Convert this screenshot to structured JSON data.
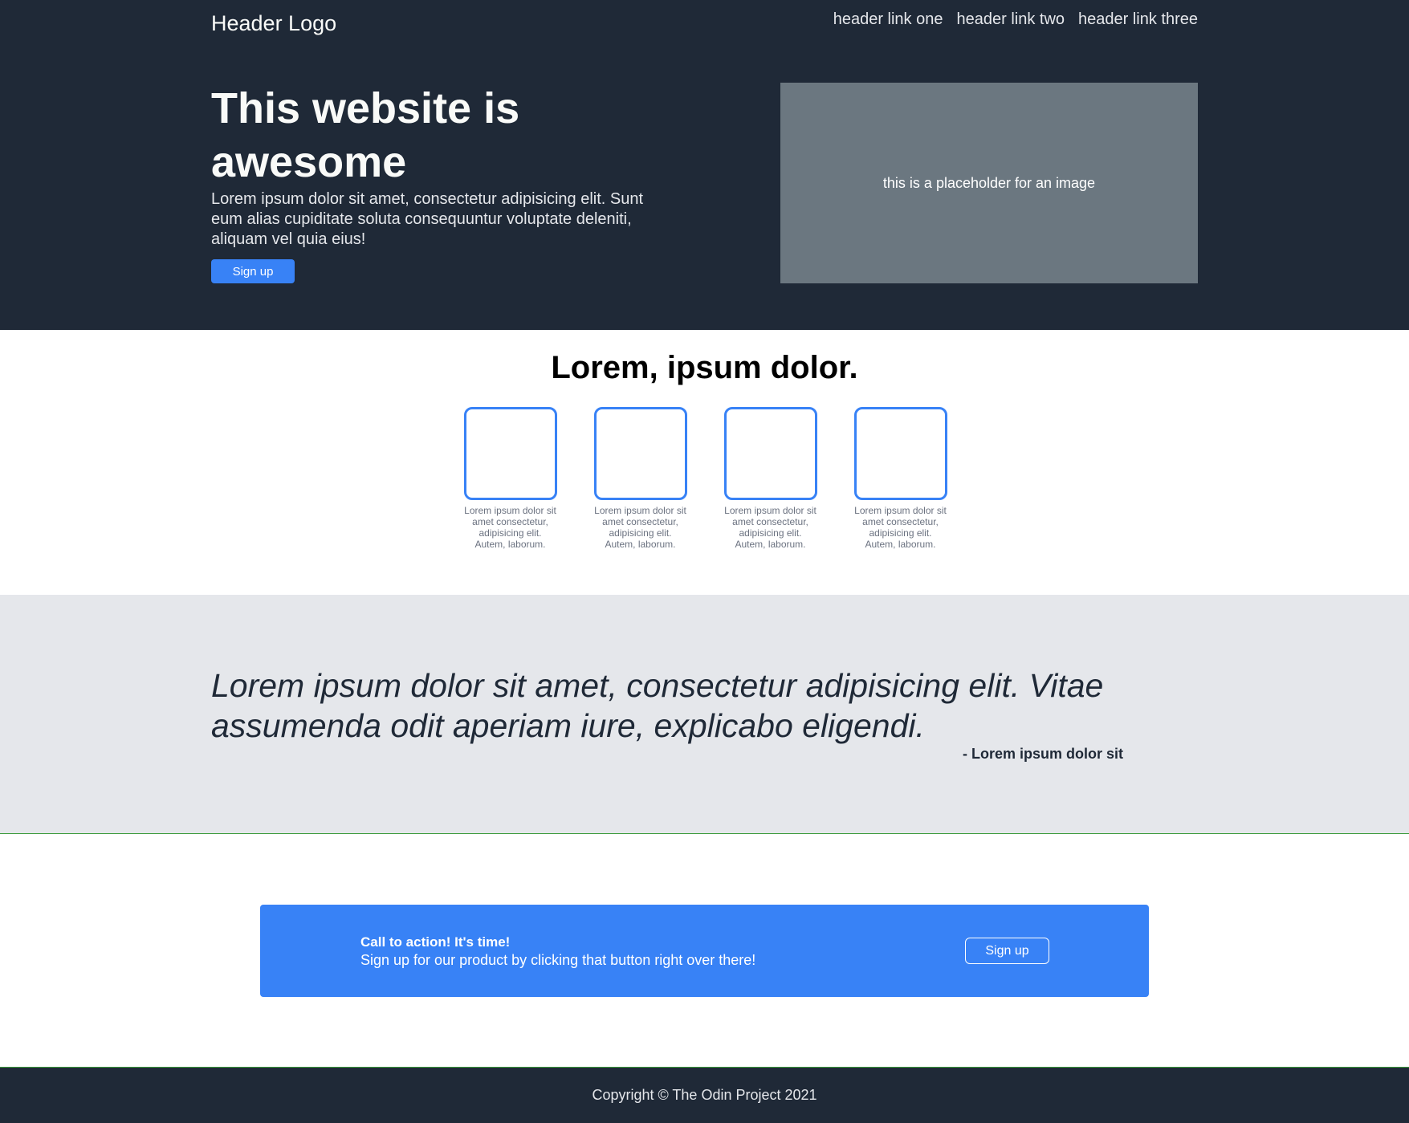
{
  "header": {
    "logo": "Header Logo",
    "links": [
      "header link one",
      "header link two",
      "header link three"
    ]
  },
  "hero": {
    "title": "This website is awesome",
    "text": "Lorem ipsum dolor sit amet, consectetur adipisicing elit. Sunt eum alias cupiditate soluta consequuntur voluptate deleniti, aliquam vel quia eius!",
    "button_label": "Sign up",
    "image_placeholder": "this is a placeholder for an image"
  },
  "info": {
    "title": "Lorem, ipsum dolor.",
    "cards": [
      {
        "caption": "Lorem ipsum dolor sit amet consectetur, adipisicing elit. Autem, laborum."
      },
      {
        "caption": "Lorem ipsum dolor sit amet consectetur, adipisicing elit. Autem, laborum."
      },
      {
        "caption": "Lorem ipsum dolor sit amet consectetur, adipisicing elit. Autem, laborum."
      },
      {
        "caption": "Lorem ipsum dolor sit amet consectetur, adipisicing elit. Autem, laborum."
      }
    ]
  },
  "quote": {
    "text": "Lorem ipsum dolor sit amet, consectetur adipisicing elit. Vitae assumenda odit aperiam iure, explicabo eligendi.",
    "author": "- Lorem ipsum dolor sit"
  },
  "cta": {
    "title": "Call to action! It's time!",
    "text": "Sign up for our product by clicking that button right over there!",
    "button_label": "Sign up"
  },
  "footer": {
    "copyright": "Copyright © The Odin Project 2021"
  },
  "colors": {
    "dark": "#1f2937",
    "accent": "#3882f6",
    "light_gray": "#e5e7eb",
    "placeholder_gray": "#6b7780"
  }
}
